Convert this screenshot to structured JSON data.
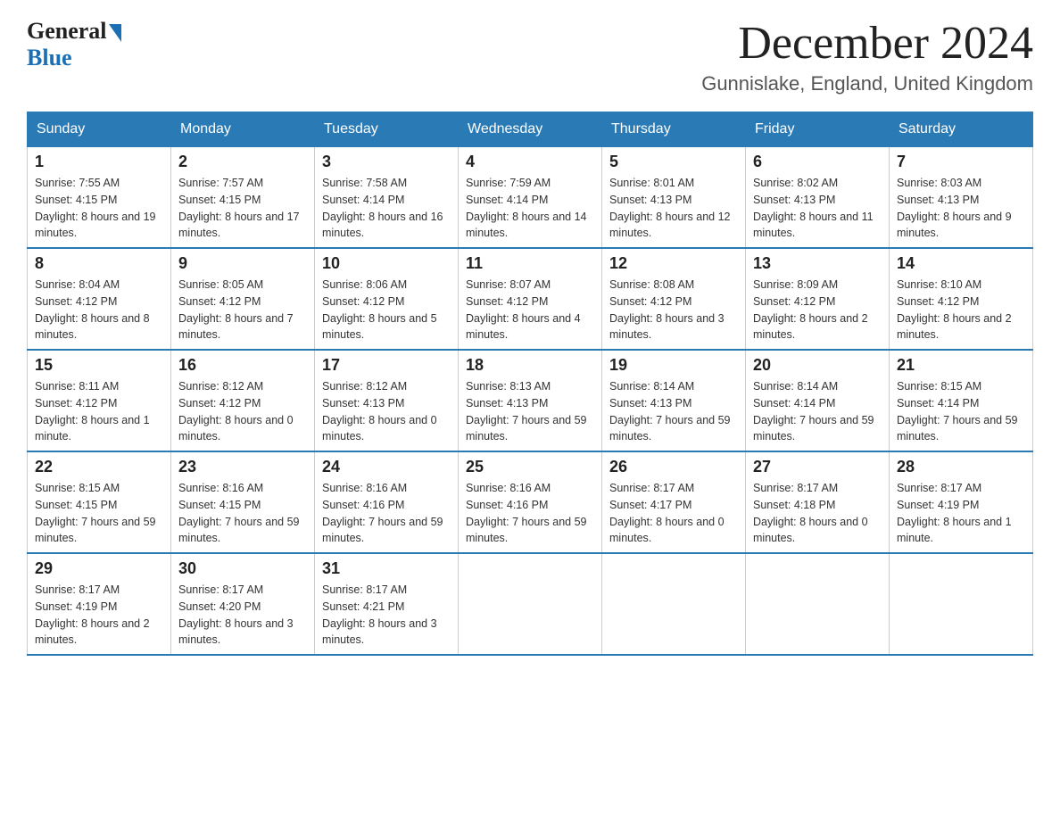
{
  "header": {
    "logo": {
      "general": "General",
      "blue": "Blue"
    },
    "month_title": "December 2024",
    "location": "Gunnislake, England, United Kingdom"
  },
  "days_of_week": [
    "Sunday",
    "Monday",
    "Tuesday",
    "Wednesday",
    "Thursday",
    "Friday",
    "Saturday"
  ],
  "weeks": [
    [
      {
        "day": 1,
        "sunrise": "7:55 AM",
        "sunset": "4:15 PM",
        "daylight": "8 hours and 19 minutes."
      },
      {
        "day": 2,
        "sunrise": "7:57 AM",
        "sunset": "4:15 PM",
        "daylight": "8 hours and 17 minutes."
      },
      {
        "day": 3,
        "sunrise": "7:58 AM",
        "sunset": "4:14 PM",
        "daylight": "8 hours and 16 minutes."
      },
      {
        "day": 4,
        "sunrise": "7:59 AM",
        "sunset": "4:14 PM",
        "daylight": "8 hours and 14 minutes."
      },
      {
        "day": 5,
        "sunrise": "8:01 AM",
        "sunset": "4:13 PM",
        "daylight": "8 hours and 12 minutes."
      },
      {
        "day": 6,
        "sunrise": "8:02 AM",
        "sunset": "4:13 PM",
        "daylight": "8 hours and 11 minutes."
      },
      {
        "day": 7,
        "sunrise": "8:03 AM",
        "sunset": "4:13 PM",
        "daylight": "8 hours and 9 minutes."
      }
    ],
    [
      {
        "day": 8,
        "sunrise": "8:04 AM",
        "sunset": "4:12 PM",
        "daylight": "8 hours and 8 minutes."
      },
      {
        "day": 9,
        "sunrise": "8:05 AM",
        "sunset": "4:12 PM",
        "daylight": "8 hours and 7 minutes."
      },
      {
        "day": 10,
        "sunrise": "8:06 AM",
        "sunset": "4:12 PM",
        "daylight": "8 hours and 5 minutes."
      },
      {
        "day": 11,
        "sunrise": "8:07 AM",
        "sunset": "4:12 PM",
        "daylight": "8 hours and 4 minutes."
      },
      {
        "day": 12,
        "sunrise": "8:08 AM",
        "sunset": "4:12 PM",
        "daylight": "8 hours and 3 minutes."
      },
      {
        "day": 13,
        "sunrise": "8:09 AM",
        "sunset": "4:12 PM",
        "daylight": "8 hours and 2 minutes."
      },
      {
        "day": 14,
        "sunrise": "8:10 AM",
        "sunset": "4:12 PM",
        "daylight": "8 hours and 2 minutes."
      }
    ],
    [
      {
        "day": 15,
        "sunrise": "8:11 AM",
        "sunset": "4:12 PM",
        "daylight": "8 hours and 1 minute."
      },
      {
        "day": 16,
        "sunrise": "8:12 AM",
        "sunset": "4:12 PM",
        "daylight": "8 hours and 0 minutes."
      },
      {
        "day": 17,
        "sunrise": "8:12 AM",
        "sunset": "4:13 PM",
        "daylight": "8 hours and 0 minutes."
      },
      {
        "day": 18,
        "sunrise": "8:13 AM",
        "sunset": "4:13 PM",
        "daylight": "7 hours and 59 minutes."
      },
      {
        "day": 19,
        "sunrise": "8:14 AM",
        "sunset": "4:13 PM",
        "daylight": "7 hours and 59 minutes."
      },
      {
        "day": 20,
        "sunrise": "8:14 AM",
        "sunset": "4:14 PM",
        "daylight": "7 hours and 59 minutes."
      },
      {
        "day": 21,
        "sunrise": "8:15 AM",
        "sunset": "4:14 PM",
        "daylight": "7 hours and 59 minutes."
      }
    ],
    [
      {
        "day": 22,
        "sunrise": "8:15 AM",
        "sunset": "4:15 PM",
        "daylight": "7 hours and 59 minutes."
      },
      {
        "day": 23,
        "sunrise": "8:16 AM",
        "sunset": "4:15 PM",
        "daylight": "7 hours and 59 minutes."
      },
      {
        "day": 24,
        "sunrise": "8:16 AM",
        "sunset": "4:16 PM",
        "daylight": "7 hours and 59 minutes."
      },
      {
        "day": 25,
        "sunrise": "8:16 AM",
        "sunset": "4:16 PM",
        "daylight": "7 hours and 59 minutes."
      },
      {
        "day": 26,
        "sunrise": "8:17 AM",
        "sunset": "4:17 PM",
        "daylight": "8 hours and 0 minutes."
      },
      {
        "day": 27,
        "sunrise": "8:17 AM",
        "sunset": "4:18 PM",
        "daylight": "8 hours and 0 minutes."
      },
      {
        "day": 28,
        "sunrise": "8:17 AM",
        "sunset": "4:19 PM",
        "daylight": "8 hours and 1 minute."
      }
    ],
    [
      {
        "day": 29,
        "sunrise": "8:17 AM",
        "sunset": "4:19 PM",
        "daylight": "8 hours and 2 minutes."
      },
      {
        "day": 30,
        "sunrise": "8:17 AM",
        "sunset": "4:20 PM",
        "daylight": "8 hours and 3 minutes."
      },
      {
        "day": 31,
        "sunrise": "8:17 AM",
        "sunset": "4:21 PM",
        "daylight": "8 hours and 3 minutes."
      },
      null,
      null,
      null,
      null
    ]
  ]
}
